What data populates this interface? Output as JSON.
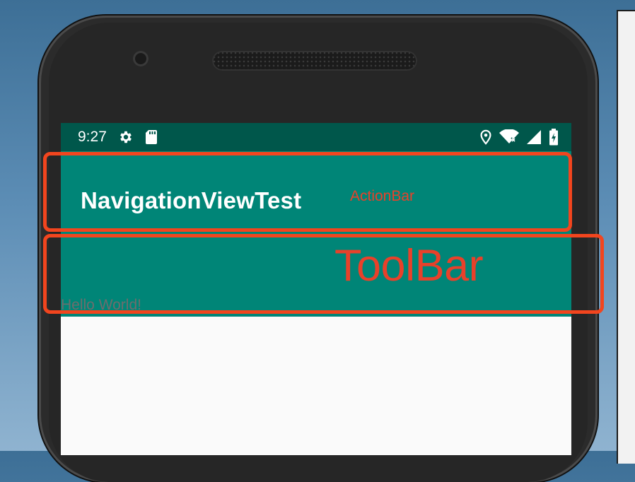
{
  "status_bar": {
    "time": "9:27",
    "left_icons": [
      "gear-icon",
      "sd-card-icon"
    ],
    "right_icons": [
      "location-icon",
      "wifi-icon",
      "signal-icon",
      "battery-icon"
    ]
  },
  "action_bar": {
    "title": "NavigationViewTest"
  },
  "content": {
    "text": "Hello World!"
  },
  "annotations": {
    "action_bar_label": "ActionBar",
    "toolbar_label": "ToolBar",
    "color": "#f2451e"
  },
  "colors": {
    "primary": "#008577",
    "primary_dark": "#00574b",
    "background": "#fafafa"
  }
}
